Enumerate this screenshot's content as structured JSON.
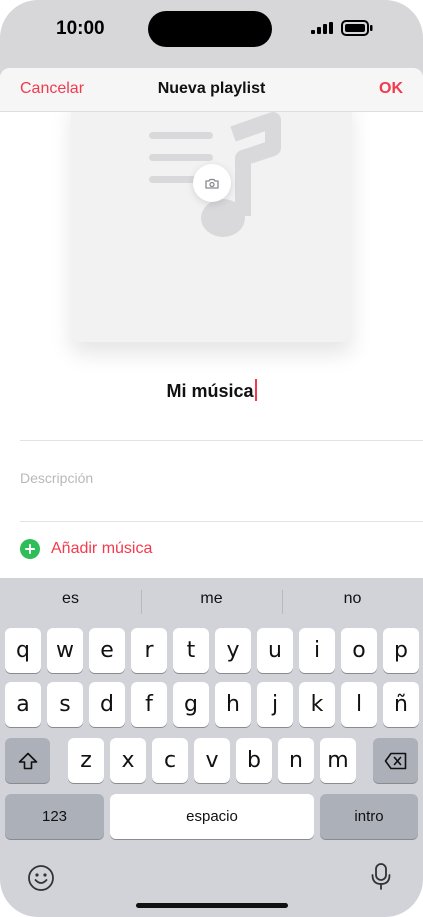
{
  "status": {
    "time": "10:00"
  },
  "nav": {
    "cancel": "Cancelar",
    "title": "Nueva playlist",
    "ok": "OK"
  },
  "playlist": {
    "name": "Mi música",
    "description_placeholder": "Descripción",
    "add_music": "Añadir música"
  },
  "keyboard": {
    "suggestions": [
      "es",
      "me",
      "no"
    ],
    "row1": [
      "q",
      "w",
      "e",
      "r",
      "t",
      "y",
      "u",
      "i",
      "o",
      "p"
    ],
    "row2": [
      "a",
      "s",
      "d",
      "f",
      "g",
      "h",
      "j",
      "k",
      "l",
      "ñ"
    ],
    "row3": [
      "z",
      "x",
      "c",
      "v",
      "b",
      "n",
      "m"
    ],
    "numbers": "123",
    "space": "espacio",
    "return": "intro"
  },
  "colors": {
    "accent": "#f23a4d",
    "add_green": "#2dbe5a",
    "keyboard_bg": "#d1d3d9",
    "key_dark": "#acb0b9"
  },
  "icons": [
    "signal-icon",
    "battery-icon",
    "music-note-icon",
    "camera-icon",
    "add-icon",
    "shift-icon",
    "delete-icon",
    "emoji-icon",
    "microphone-icon"
  ]
}
